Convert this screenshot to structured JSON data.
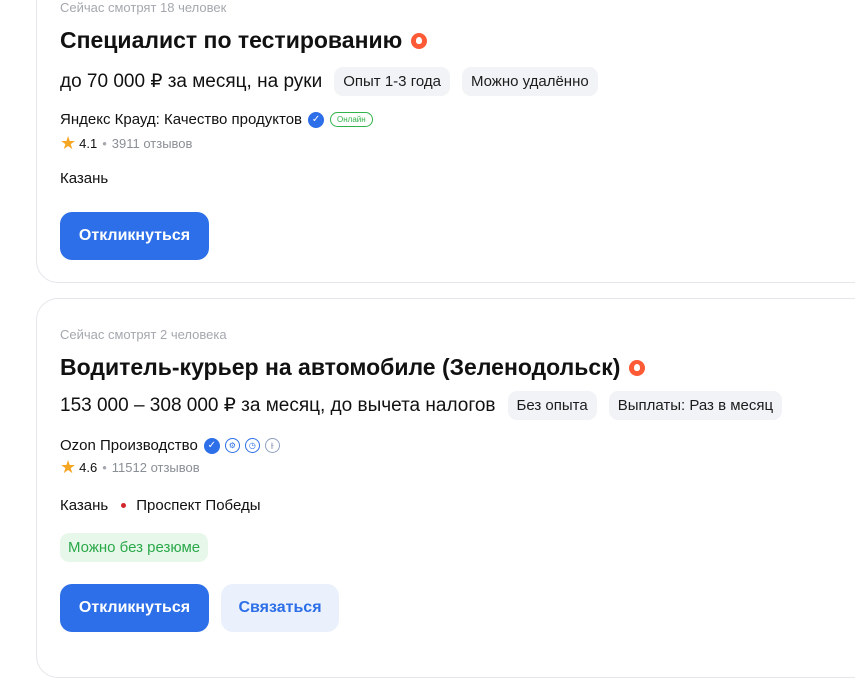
{
  "vacancies": [
    {
      "viewers": "Сейчас смотрят 18 человек",
      "title": "Специалист по тестированию",
      "salary": "до 70 000 ₽ за месяц, на руки",
      "tags": [
        "Опыт 1-3 года",
        "Можно удалённо"
      ],
      "company": "Яндекс Крауд: Качество продуктов",
      "online_badge": "Онлайн",
      "rating": "4.1",
      "reviews": "3911 отзывов",
      "city": "Казань",
      "apply_label": "Откликнуться"
    },
    {
      "viewers": "Сейчас смотрят 2 человека",
      "title": "Водитель-курьер на автомобиле (Зеленодольск)",
      "salary": "153 000 – 308 000 ₽ за месяц, до вычета налогов",
      "tags": [
        "Без опыта",
        "Выплаты: Раз в месяц"
      ],
      "company": "Ozon Производство",
      "rating": "4.6",
      "reviews": "11512 отзывов",
      "city": "Казань",
      "metro": "Проспект Победы",
      "no_resume": "Можно без резюме",
      "apply_label": "Откликнуться",
      "contact_label": "Связаться"
    }
  ],
  "colors": {
    "accent": "#2d6fe8",
    "hot": "#ff5a36",
    "online": "#32b34a",
    "metro": "#d3262b"
  }
}
